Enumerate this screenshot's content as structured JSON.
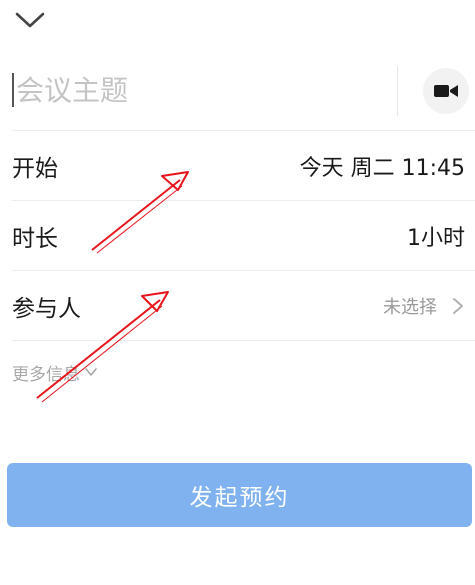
{
  "header": {
    "collapse_icon": "chevron-down-icon"
  },
  "topic": {
    "placeholder": "会议主题",
    "value": "",
    "video_icon": "video-camera-icon"
  },
  "fields": {
    "start": {
      "label": "开始",
      "value": "今天 周二 11:45"
    },
    "duration": {
      "label": "时长",
      "value": "1小时"
    },
    "participants": {
      "label": "参与人",
      "value": "未选择",
      "icon": "chevron-right-icon"
    }
  },
  "more_info": {
    "label": "更多信息",
    "icon": "chevron-down-icon"
  },
  "submit": {
    "label": "发起预约"
  },
  "colors": {
    "primary_disabled": "#7fb2ee",
    "annotation_arrow": "#e8141c",
    "divider": "#ececec",
    "muted_text": "#9a9a9a"
  },
  "annotations": {
    "arrow_icon": "red-arrow-annotation"
  }
}
